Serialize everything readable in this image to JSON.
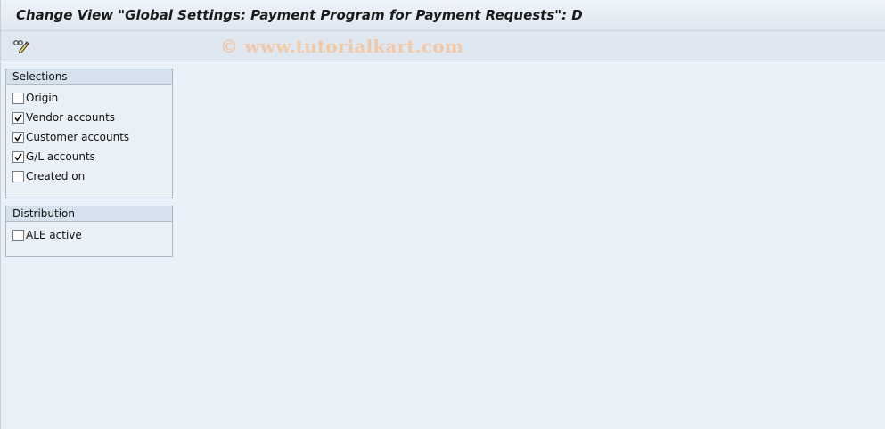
{
  "window": {
    "title": "Change View \"Global Settings: Payment Program for Payment Requests\": D"
  },
  "toolbar": {
    "edit_icon": "display-change-pencil-icon"
  },
  "watermark": "© www.tutorialkart.com",
  "selections": {
    "header": "Selections",
    "items": [
      {
        "label": "Origin",
        "checked": false
      },
      {
        "label": "Vendor accounts",
        "checked": true
      },
      {
        "label": "Customer accounts",
        "checked": true
      },
      {
        "label": "G/L accounts",
        "checked": true
      },
      {
        "label": "Created on",
        "checked": false
      }
    ]
  },
  "distribution": {
    "header": "Distribution",
    "items": [
      {
        "label": "ALE active",
        "checked": false
      }
    ]
  }
}
